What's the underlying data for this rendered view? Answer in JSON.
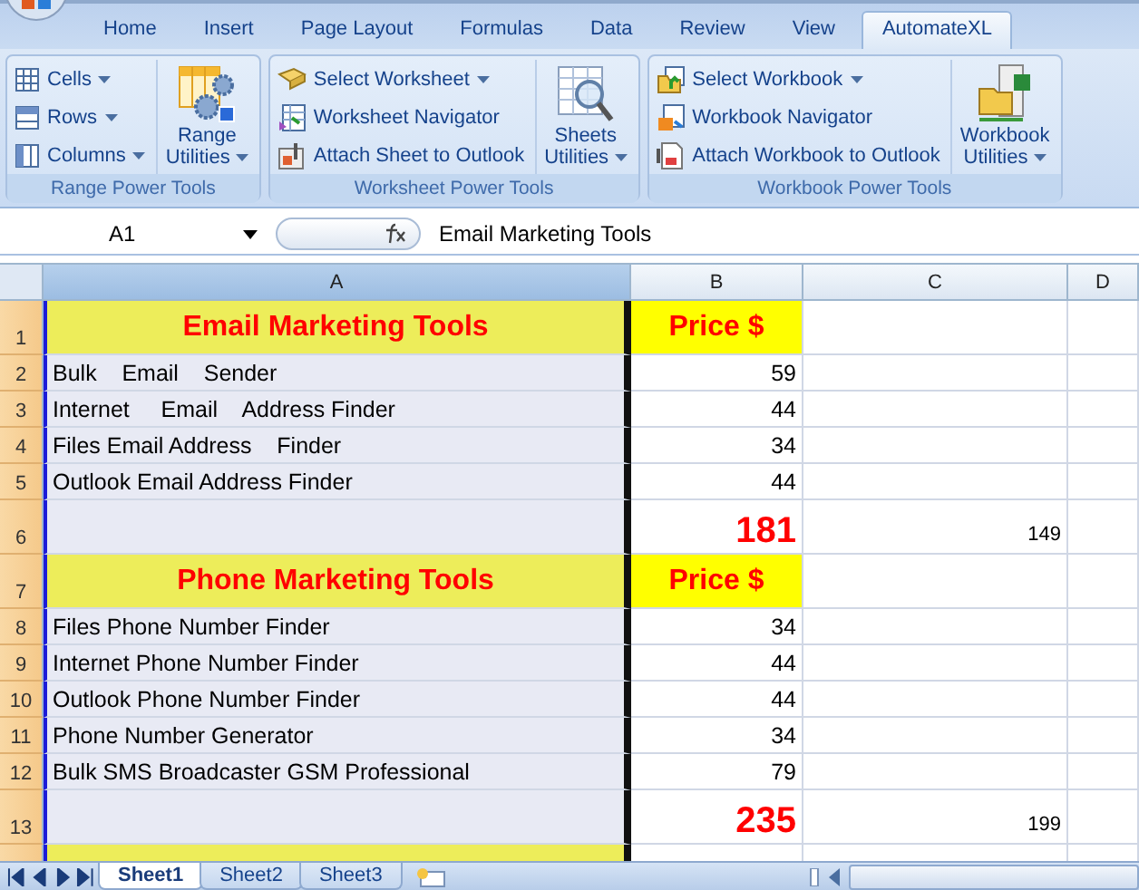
{
  "ribbon_tabs": [
    {
      "label": "Home",
      "selected": false
    },
    {
      "label": "Insert",
      "selected": false
    },
    {
      "label": "Page Layout",
      "selected": false
    },
    {
      "label": "Formulas",
      "selected": false
    },
    {
      "label": "Data",
      "selected": false
    },
    {
      "label": "Review",
      "selected": false
    },
    {
      "label": "View",
      "selected": false
    },
    {
      "label": "AutomateXL",
      "selected": true
    }
  ],
  "ribbon_groups": [
    {
      "title": "Range Power Tools",
      "small": [
        {
          "label": "Cells",
          "dropdown": true
        },
        {
          "label": "Rows",
          "dropdown": true
        },
        {
          "label": "Columns",
          "dropdown": true
        }
      ],
      "large": {
        "lines": [
          "Range",
          "Utilities"
        ],
        "dropdown": true
      }
    },
    {
      "title": "Worksheet Power Tools",
      "small": [
        {
          "label": "Select Worksheet",
          "dropdown": true
        },
        {
          "label": "Worksheet Navigator",
          "dropdown": false
        },
        {
          "label": "Attach Sheet to Outlook",
          "dropdown": false
        }
      ],
      "large": {
        "lines": [
          "Sheets",
          "Utilities"
        ],
        "dropdown": true
      }
    },
    {
      "title": "Workbook Power Tools",
      "small": [
        {
          "label": "Select Workbook",
          "dropdown": true
        },
        {
          "label": "Workbook Navigator",
          "dropdown": false
        },
        {
          "label": "Attach Workbook to Outlook",
          "dropdown": false
        }
      ],
      "large": {
        "lines": [
          "Workbook",
          "Utilities"
        ],
        "dropdown": true
      }
    }
  ],
  "formula_bar": {
    "name_box": "A1",
    "formula": "Email Marketing Tools"
  },
  "columns": [
    {
      "label": "A",
      "selected": true
    },
    {
      "label": "B",
      "selected": false
    },
    {
      "label": "C",
      "selected": false
    },
    {
      "label": "D",
      "selected": false
    }
  ],
  "rows": [
    {
      "number": "1",
      "kind": "header",
      "cells": [
        "Email Marketing Tools",
        "Price $",
        ""
      ]
    },
    {
      "number": "2",
      "kind": "item",
      "cells": [
        "Bulk    Email    Sender",
        "59",
        ""
      ]
    },
    {
      "number": "3",
      "kind": "item",
      "cells": [
        "Internet     Email    Address Finder",
        "44",
        ""
      ]
    },
    {
      "number": "4",
      "kind": "item",
      "cells": [
        "Files Email Address    Finder",
        "34",
        ""
      ]
    },
    {
      "number": "5",
      "kind": "item",
      "cells": [
        "Outlook Email Address Finder",
        "44",
        ""
      ]
    },
    {
      "number": "6",
      "kind": "total",
      "cells": [
        "",
        "181",
        "149"
      ]
    },
    {
      "number": "7",
      "kind": "header",
      "cells": [
        "Phone Marketing Tools",
        "Price $",
        ""
      ]
    },
    {
      "number": "8",
      "kind": "item",
      "cells": [
        "Files Phone Number Finder",
        "34",
        ""
      ]
    },
    {
      "number": "9",
      "kind": "item",
      "cells": [
        "Internet Phone Number Finder",
        "44",
        ""
      ]
    },
    {
      "number": "10",
      "kind": "item",
      "cells": [
        "Outlook Phone Number Finder",
        "44",
        ""
      ]
    },
    {
      "number": "11",
      "kind": "item",
      "cells": [
        "Phone Number Generator",
        "34",
        ""
      ]
    },
    {
      "number": "12",
      "kind": "item",
      "cells": [
        "Bulk SMS Broadcaster GSM Professional",
        "79",
        ""
      ]
    },
    {
      "number": "13",
      "kind": "total",
      "cells": [
        "",
        "235",
        "199"
      ]
    },
    {
      "number": "",
      "kind": "partial",
      "cells": [
        "",
        "",
        ""
      ]
    }
  ],
  "sheet_tabs": [
    {
      "label": "Sheet1",
      "selected": true
    },
    {
      "label": "Sheet2",
      "selected": false
    },
    {
      "label": "Sheet3",
      "selected": false
    }
  ]
}
